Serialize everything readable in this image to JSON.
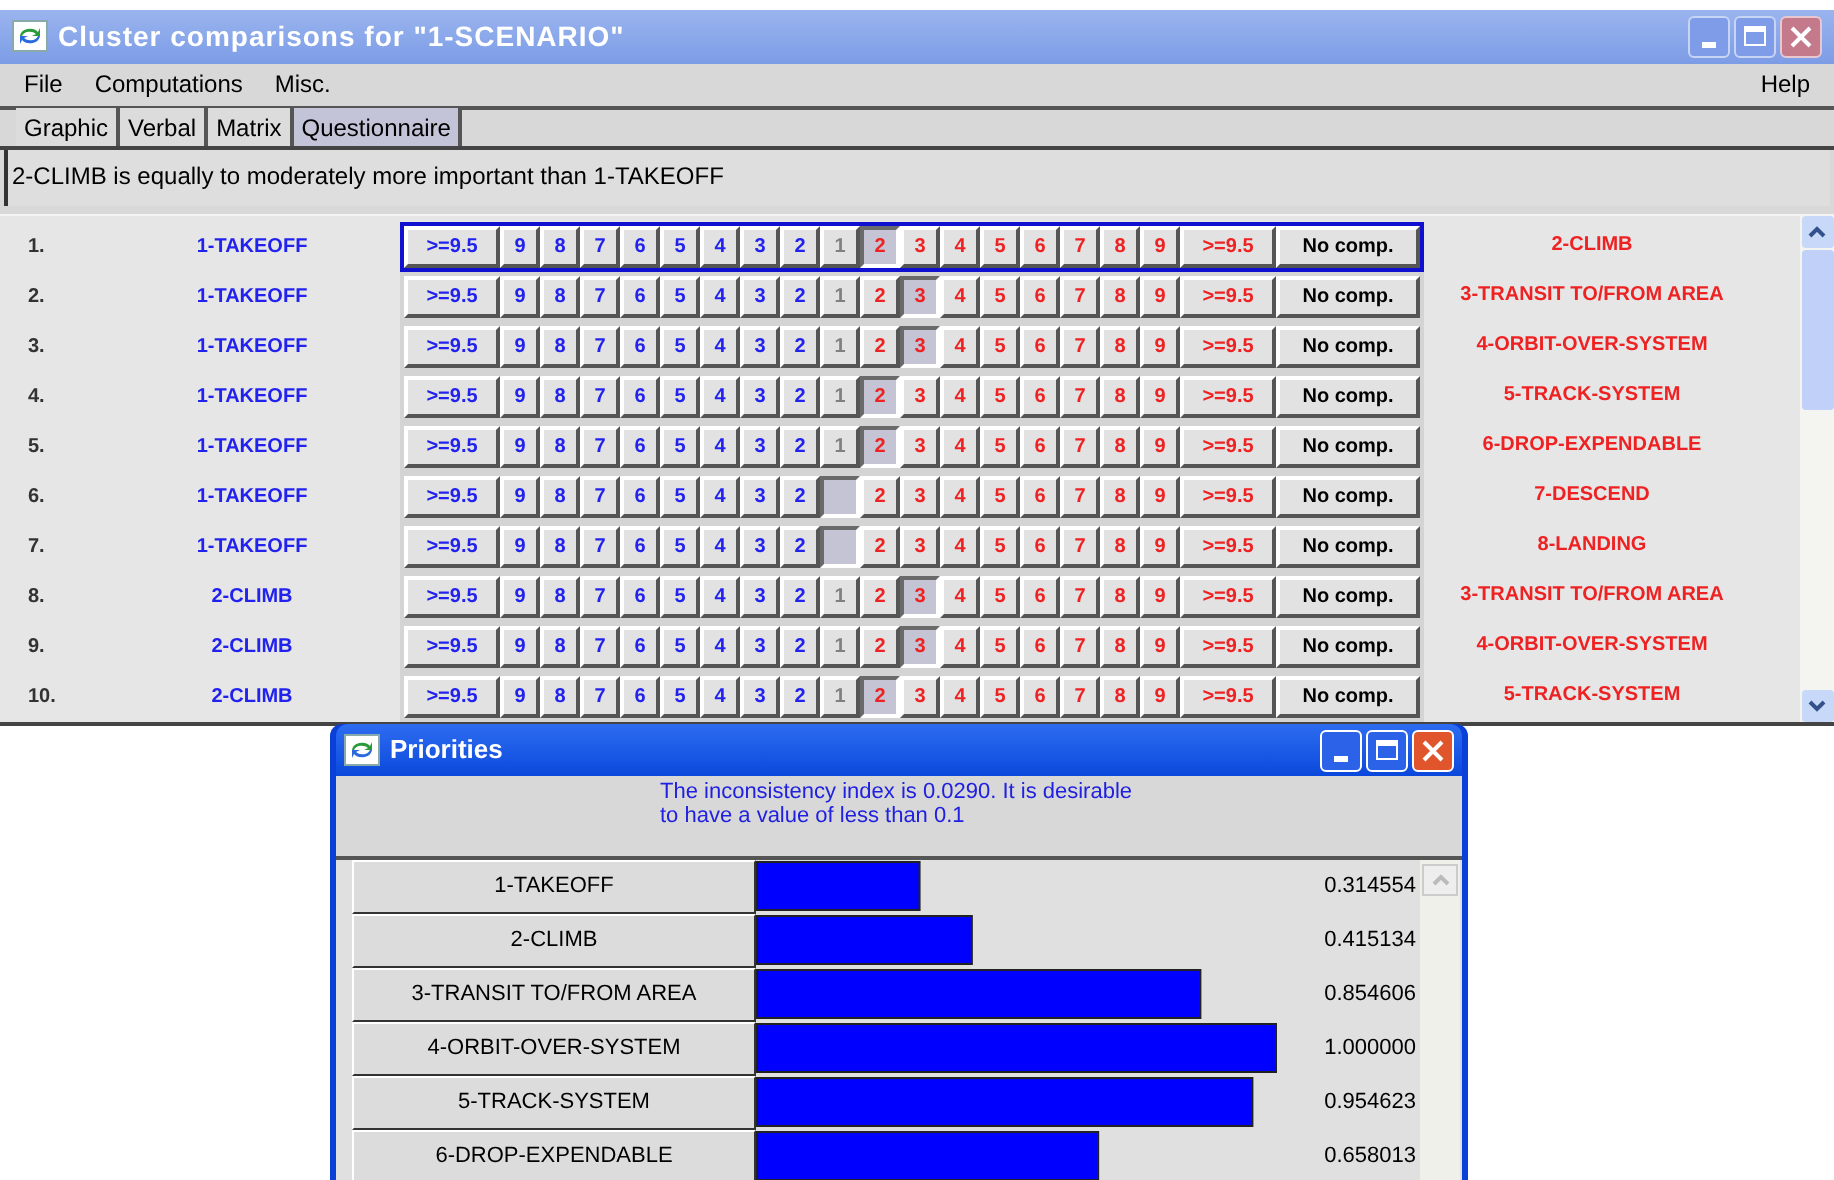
{
  "window": {
    "title": "Cluster comparisons for \"1-SCENARIO\""
  },
  "menu": [
    {
      "label": "File"
    },
    {
      "label": "Computations"
    },
    {
      "label": "Misc."
    }
  ],
  "help": "Help",
  "tabs": [
    {
      "label": "Graphic",
      "selected": false
    },
    {
      "label": "Verbal",
      "selected": false
    },
    {
      "label": "Matrix",
      "selected": false
    },
    {
      "label": "Questionnaire",
      "selected": true
    }
  ],
  "message": "2-CLIMB is equally to moderately more important than  1-TAKEOFF",
  "comparisons": [
    {
      "number": "1.",
      "left": "1-TAKEOFF",
      "right": "2-CLIMB",
      "focused": true,
      "cells": [
        {
          "label": ">=9.5",
          "selected": false
        },
        {
          "label": "9",
          "selected": false
        },
        {
          "label": "8",
          "selected": false
        },
        {
          "label": "7",
          "selected": false
        },
        {
          "label": "6",
          "selected": false
        },
        {
          "label": "5",
          "selected": false
        },
        {
          "label": "4",
          "selected": false
        },
        {
          "label": "3",
          "selected": false
        },
        {
          "label": "2",
          "selected": false
        },
        {
          "label": "1",
          "selected": false
        },
        {
          "label": "2",
          "selected": true
        },
        {
          "label": "3",
          "selected": false
        },
        {
          "label": "4",
          "selected": false
        },
        {
          "label": "5",
          "selected": false
        },
        {
          "label": "6",
          "selected": false
        },
        {
          "label": "7",
          "selected": false
        },
        {
          "label": "8",
          "selected": false
        },
        {
          "label": "9",
          "selected": false
        },
        {
          "label": ">=9.5",
          "selected": false
        },
        {
          "label": "No comp.",
          "selected": false
        }
      ]
    },
    {
      "number": "2.",
      "left": "1-TAKEOFF",
      "right": "3-TRANSIT TO/FROM AREA",
      "focused": false,
      "cells": [
        {
          "label": ">=9.5",
          "selected": false
        },
        {
          "label": "9",
          "selected": false
        },
        {
          "label": "8",
          "selected": false
        },
        {
          "label": "7",
          "selected": false
        },
        {
          "label": "6",
          "selected": false
        },
        {
          "label": "5",
          "selected": false
        },
        {
          "label": "4",
          "selected": false
        },
        {
          "label": "3",
          "selected": false
        },
        {
          "label": "2",
          "selected": false
        },
        {
          "label": "1",
          "selected": false
        },
        {
          "label": "2",
          "selected": false
        },
        {
          "label": "3",
          "selected": true
        },
        {
          "label": "4",
          "selected": false
        },
        {
          "label": "5",
          "selected": false
        },
        {
          "label": "6",
          "selected": false
        },
        {
          "label": "7",
          "selected": false
        },
        {
          "label": "8",
          "selected": false
        },
        {
          "label": "9",
          "selected": false
        },
        {
          "label": ">=9.5",
          "selected": false
        },
        {
          "label": "No comp.",
          "selected": false
        }
      ]
    },
    {
      "number": "3.",
      "left": "1-TAKEOFF",
      "right": "4-ORBIT-OVER-SYSTEM",
      "focused": false,
      "cells": [
        {
          "label": ">=9.5",
          "selected": false
        },
        {
          "label": "9",
          "selected": false
        },
        {
          "label": "8",
          "selected": false
        },
        {
          "label": "7",
          "selected": false
        },
        {
          "label": "6",
          "selected": false
        },
        {
          "label": "5",
          "selected": false
        },
        {
          "label": "4",
          "selected": false
        },
        {
          "label": "3",
          "selected": false
        },
        {
          "label": "2",
          "selected": false
        },
        {
          "label": "1",
          "selected": false
        },
        {
          "label": "2",
          "selected": false
        },
        {
          "label": "3",
          "selected": true
        },
        {
          "label": "4",
          "selected": false
        },
        {
          "label": "5",
          "selected": false
        },
        {
          "label": "6",
          "selected": false
        },
        {
          "label": "7",
          "selected": false
        },
        {
          "label": "8",
          "selected": false
        },
        {
          "label": "9",
          "selected": false
        },
        {
          "label": ">=9.5",
          "selected": false
        },
        {
          "label": "No comp.",
          "selected": false
        }
      ]
    },
    {
      "number": "4.",
      "left": "1-TAKEOFF",
      "right": "5-TRACK-SYSTEM",
      "focused": false,
      "cells": [
        {
          "label": ">=9.5",
          "selected": false
        },
        {
          "label": "9",
          "selected": false
        },
        {
          "label": "8",
          "selected": false
        },
        {
          "label": "7",
          "selected": false
        },
        {
          "label": "6",
          "selected": false
        },
        {
          "label": "5",
          "selected": false
        },
        {
          "label": "4",
          "selected": false
        },
        {
          "label": "3",
          "selected": false
        },
        {
          "label": "2",
          "selected": false
        },
        {
          "label": "1",
          "selected": false
        },
        {
          "label": "2",
          "selected": true
        },
        {
          "label": "3",
          "selected": false
        },
        {
          "label": "4",
          "selected": false
        },
        {
          "label": "5",
          "selected": false
        },
        {
          "label": "6",
          "selected": false
        },
        {
          "label": "7",
          "selected": false
        },
        {
          "label": "8",
          "selected": false
        },
        {
          "label": "9",
          "selected": false
        },
        {
          "label": ">=9.5",
          "selected": false
        },
        {
          "label": "No comp.",
          "selected": false
        }
      ]
    },
    {
      "number": "5.",
      "left": "1-TAKEOFF",
      "right": "6-DROP-EXPENDABLE",
      "focused": false,
      "cells": [
        {
          "label": ">=9.5",
          "selected": false
        },
        {
          "label": "9",
          "selected": false
        },
        {
          "label": "8",
          "selected": false
        },
        {
          "label": "7",
          "selected": false
        },
        {
          "label": "6",
          "selected": false
        },
        {
          "label": "5",
          "selected": false
        },
        {
          "label": "4",
          "selected": false
        },
        {
          "label": "3",
          "selected": false
        },
        {
          "label": "2",
          "selected": false
        },
        {
          "label": "1",
          "selected": false
        },
        {
          "label": "2",
          "selected": true
        },
        {
          "label": "3",
          "selected": false
        },
        {
          "label": "4",
          "selected": false
        },
        {
          "label": "5",
          "selected": false
        },
        {
          "label": "6",
          "selected": false
        },
        {
          "label": "7",
          "selected": false
        },
        {
          "label": "8",
          "selected": false
        },
        {
          "label": "9",
          "selected": false
        },
        {
          "label": ">=9.5",
          "selected": false
        },
        {
          "label": "No comp.",
          "selected": false
        }
      ]
    },
    {
      "number": "6.",
      "left": "1-TAKEOFF",
      "right": "7-DESCEND",
      "focused": false,
      "cells": [
        {
          "label": ">=9.5",
          "selected": false
        },
        {
          "label": "9",
          "selected": false
        },
        {
          "label": "8",
          "selected": false
        },
        {
          "label": "7",
          "selected": false
        },
        {
          "label": "6",
          "selected": false
        },
        {
          "label": "5",
          "selected": false
        },
        {
          "label": "4",
          "selected": false
        },
        {
          "label": "3",
          "selected": false
        },
        {
          "label": "2",
          "selected": false
        },
        {
          "selected": true
        },
        {
          "label": "2",
          "selected": false
        },
        {
          "label": "3",
          "selected": false
        },
        {
          "label": "4",
          "selected": false
        },
        {
          "label": "5",
          "selected": false
        },
        {
          "label": "6",
          "selected": false
        },
        {
          "label": "7",
          "selected": false
        },
        {
          "label": "8",
          "selected": false
        },
        {
          "label": "9",
          "selected": false
        },
        {
          "label": ">=9.5",
          "selected": false
        },
        {
          "label": "No comp.",
          "selected": false
        }
      ]
    },
    {
      "number": "7.",
      "left": "1-TAKEOFF",
      "right": "8-LANDING",
      "focused": false,
      "cells": [
        {
          "label": ">=9.5",
          "selected": false
        },
        {
          "label": "9",
          "selected": false
        },
        {
          "label": "8",
          "selected": false
        },
        {
          "label": "7",
          "selected": false
        },
        {
          "label": "6",
          "selected": false
        },
        {
          "label": "5",
          "selected": false
        },
        {
          "label": "4",
          "selected": false
        },
        {
          "label": "3",
          "selected": false
        },
        {
          "label": "2",
          "selected": false
        },
        {
          "selected": true
        },
        {
          "label": "2",
          "selected": false
        },
        {
          "label": "3",
          "selected": false
        },
        {
          "label": "4",
          "selected": false
        },
        {
          "label": "5",
          "selected": false
        },
        {
          "label": "6",
          "selected": false
        },
        {
          "label": "7",
          "selected": false
        },
        {
          "label": "8",
          "selected": false
        },
        {
          "label": "9",
          "selected": false
        },
        {
          "label": ">=9.5",
          "selected": false
        },
        {
          "label": "No comp.",
          "selected": false
        }
      ]
    },
    {
      "number": "8.",
      "left": "2-CLIMB",
      "right": "3-TRANSIT TO/FROM AREA",
      "focused": false,
      "cells": [
        {
          "label": ">=9.5",
          "selected": false
        },
        {
          "label": "9",
          "selected": false
        },
        {
          "label": "8",
          "selected": false
        },
        {
          "label": "7",
          "selected": false
        },
        {
          "label": "6",
          "selected": false
        },
        {
          "label": "5",
          "selected": false
        },
        {
          "label": "4",
          "selected": false
        },
        {
          "label": "3",
          "selected": false
        },
        {
          "label": "2",
          "selected": false
        },
        {
          "label": "1",
          "selected": false
        },
        {
          "label": "2",
          "selected": false
        },
        {
          "label": "3",
          "selected": true
        },
        {
          "label": "4",
          "selected": false
        },
        {
          "label": "5",
          "selected": false
        },
        {
          "label": "6",
          "selected": false
        },
        {
          "label": "7",
          "selected": false
        },
        {
          "label": "8",
          "selected": false
        },
        {
          "label": "9",
          "selected": false
        },
        {
          "label": ">=9.5",
          "selected": false
        },
        {
          "label": "No comp.",
          "selected": false
        }
      ]
    },
    {
      "number": "9.",
      "left": "2-CLIMB",
      "right": "4-ORBIT-OVER-SYSTEM",
      "focused": false,
      "cells": [
        {
          "label": ">=9.5",
          "selected": false
        },
        {
          "label": "9",
          "selected": false
        },
        {
          "label": "8",
          "selected": false
        },
        {
          "label": "7",
          "selected": false
        },
        {
          "label": "6",
          "selected": false
        },
        {
          "label": "5",
          "selected": false
        },
        {
          "label": "4",
          "selected": false
        },
        {
          "label": "3",
          "selected": false
        },
        {
          "label": "2",
          "selected": false
        },
        {
          "label": "1",
          "selected": false
        },
        {
          "label": "2",
          "selected": false
        },
        {
          "label": "3",
          "selected": true
        },
        {
          "label": "4",
          "selected": false
        },
        {
          "label": "5",
          "selected": false
        },
        {
          "label": "6",
          "selected": false
        },
        {
          "label": "7",
          "selected": false
        },
        {
          "label": "8",
          "selected": false
        },
        {
          "label": "9",
          "selected": false
        },
        {
          "label": ">=9.5",
          "selected": false
        },
        {
          "label": "No comp.",
          "selected": false
        }
      ]
    },
    {
      "number": "10.",
      "left": "2-CLIMB",
      "right": "5-TRACK-SYSTEM",
      "focused": false,
      "cells": [
        {
          "label": ">=9.5",
          "selected": false
        },
        {
          "label": "9",
          "selected": false
        },
        {
          "label": "8",
          "selected": false
        },
        {
          "label": "7",
          "selected": false
        },
        {
          "label": "6",
          "selected": false
        },
        {
          "label": "5",
          "selected": false
        },
        {
          "label": "4",
          "selected": false
        },
        {
          "label": "3",
          "selected": false
        },
        {
          "label": "2",
          "selected": false
        },
        {
          "label": "1",
          "selected": false
        },
        {
          "label": "2",
          "selected": true
        },
        {
          "label": "3",
          "selected": false
        },
        {
          "label": "4",
          "selected": false
        },
        {
          "label": "5",
          "selected": false
        },
        {
          "label": "6",
          "selected": false
        },
        {
          "label": "7",
          "selected": false
        },
        {
          "label": "8",
          "selected": false
        },
        {
          "label": "9",
          "selected": false
        },
        {
          "label": ">=9.5",
          "selected": false
        },
        {
          "label": "No comp.",
          "selected": false
        }
      ]
    }
  ],
  "priorities": {
    "title": "Priorities",
    "message": "The inconsistency index is 0.0290.  It is desirable to have a value of less than 0.1",
    "chart_data": {
      "type": "bar",
      "orientation": "horizontal",
      "categories": [
        "1-TAKEOFF",
        "2-CLIMB",
        "3-TRANSIT TO/FROM AREA",
        "4-ORBIT-OVER-SYSTEM",
        "5-TRACK-SYSTEM",
        "6-DROP-EXPENDABLE"
      ],
      "values": [
        0.314554,
        0.415134,
        0.854606,
        1.0,
        0.954623,
        0.658013
      ],
      "value_labels": [
        "0.314554",
        "0.415134",
        "0.854606",
        "1.000000",
        "0.954623",
        "0.658013"
      ]
    }
  }
}
